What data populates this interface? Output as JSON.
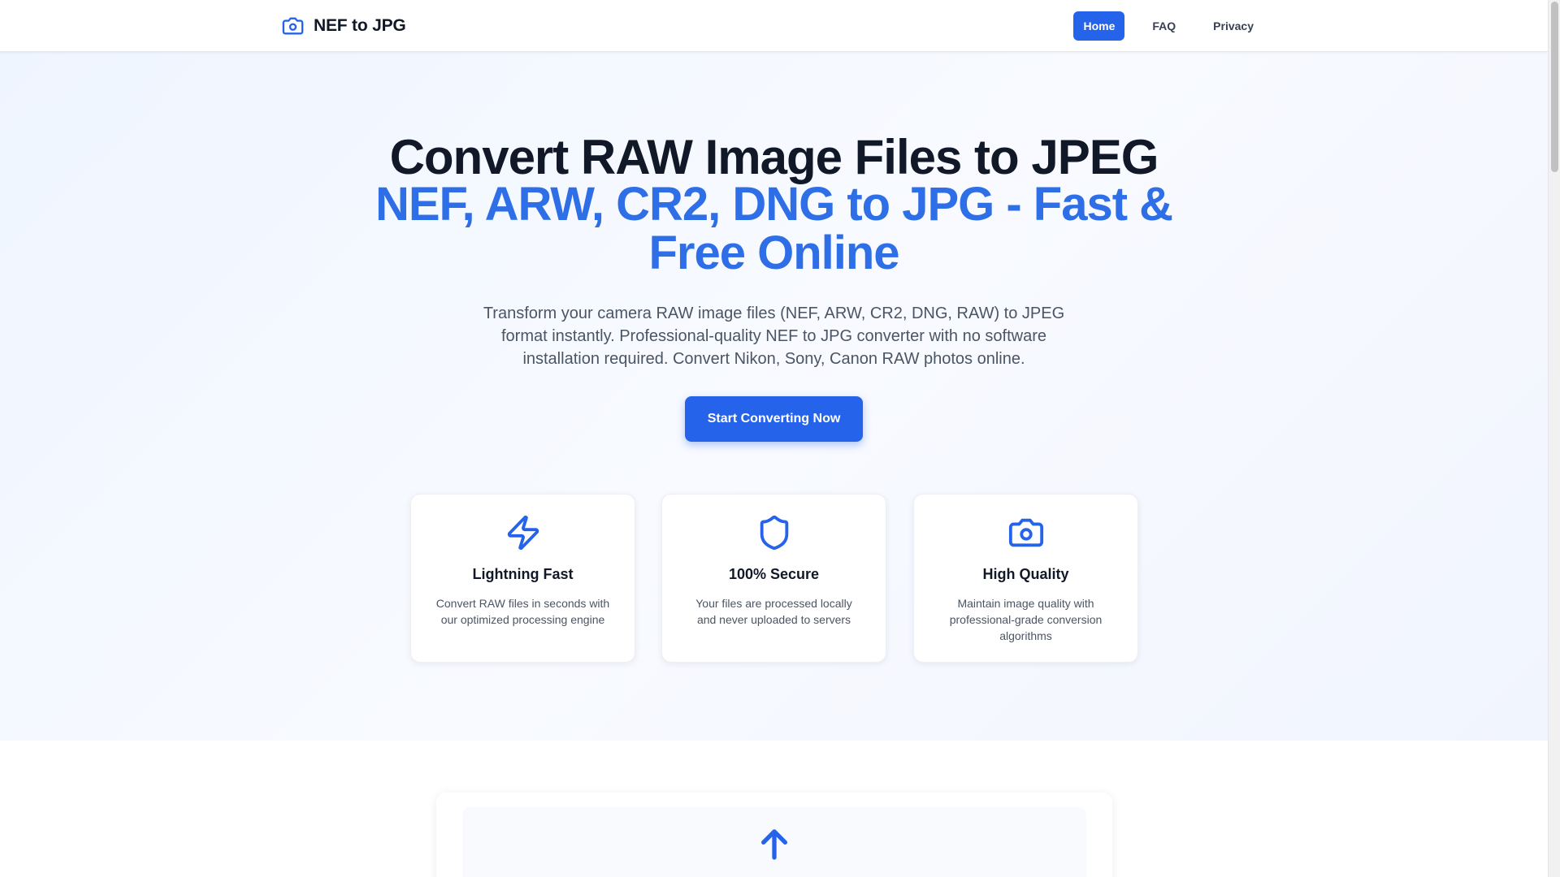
{
  "header": {
    "logo_text": "NEF to JPG",
    "nav": [
      {
        "label": "Home",
        "active": true
      },
      {
        "label": "FAQ",
        "active": false
      },
      {
        "label": "Privacy",
        "active": false
      }
    ]
  },
  "hero": {
    "title": "Convert RAW Image Files to JPEG",
    "subtitle": "NEF, ARW, CR2, DNG to JPG - Fast & Free Online",
    "description": "Transform your camera RAW image files (NEF, ARW, CR2, DNG, RAW) to JPEG format instantly. Professional-quality NEF to JPG converter with no software installation required. Convert Nikon, Sony, Canon RAW photos online.",
    "cta_label": "Start Converting Now"
  },
  "features": [
    {
      "icon": "lightning-icon",
      "title": "Lightning Fast",
      "description": "Convert RAW files in seconds with our optimized processing engine"
    },
    {
      "icon": "shield-icon",
      "title": "100% Secure",
      "description": "Your files are processed locally and never uploaded to servers"
    },
    {
      "icon": "camera-icon",
      "title": "High Quality",
      "description": "Maintain image quality with professional-grade conversion algorithms"
    }
  ],
  "upload": {
    "icon": "upload-arrow-icon"
  },
  "colors": {
    "accent": "#2563eb",
    "subtitle": "#2e6ee6",
    "text": "#111827",
    "muted": "#4b5563"
  }
}
